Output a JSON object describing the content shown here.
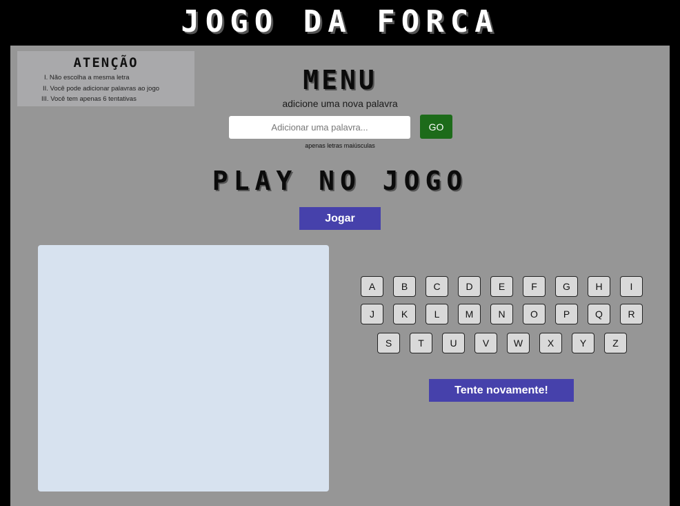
{
  "header": {
    "title": "JOGO DA FORCA"
  },
  "notice": {
    "title": "ATENÇÃO",
    "items": [
      "I. Não escolha a mesma letra",
      "II. Você pode adicionar palavras ao jogo",
      "III. Você tem apenas 6 tentativas"
    ]
  },
  "menu": {
    "title": "MENU",
    "subtitle": "adicione uma nova palavra",
    "input_placeholder": "Adicionar uma palavra...",
    "input_value": "",
    "go_label": "GO",
    "hint": "apenas letras maiúsculas"
  },
  "play": {
    "title": "PLAY NO JOGO",
    "button_label": "Jogar"
  },
  "keyboard": {
    "rows": [
      [
        "A",
        "B",
        "C",
        "D",
        "E",
        "F",
        "G",
        "H",
        "I"
      ],
      [
        "J",
        "K",
        "L",
        "M",
        "N",
        "O",
        "P",
        "Q",
        "R"
      ],
      [
        "S",
        "T",
        "U",
        "V",
        "W",
        "X",
        "Y",
        "Z"
      ]
    ]
  },
  "retry": {
    "label": "Tente novamente!"
  },
  "colors": {
    "page_background": "#000000",
    "panel_background": "#969696",
    "go_button": "#1d6b1a",
    "primary_button": "#4641ab",
    "canvas_background": "#d7e2ef"
  }
}
